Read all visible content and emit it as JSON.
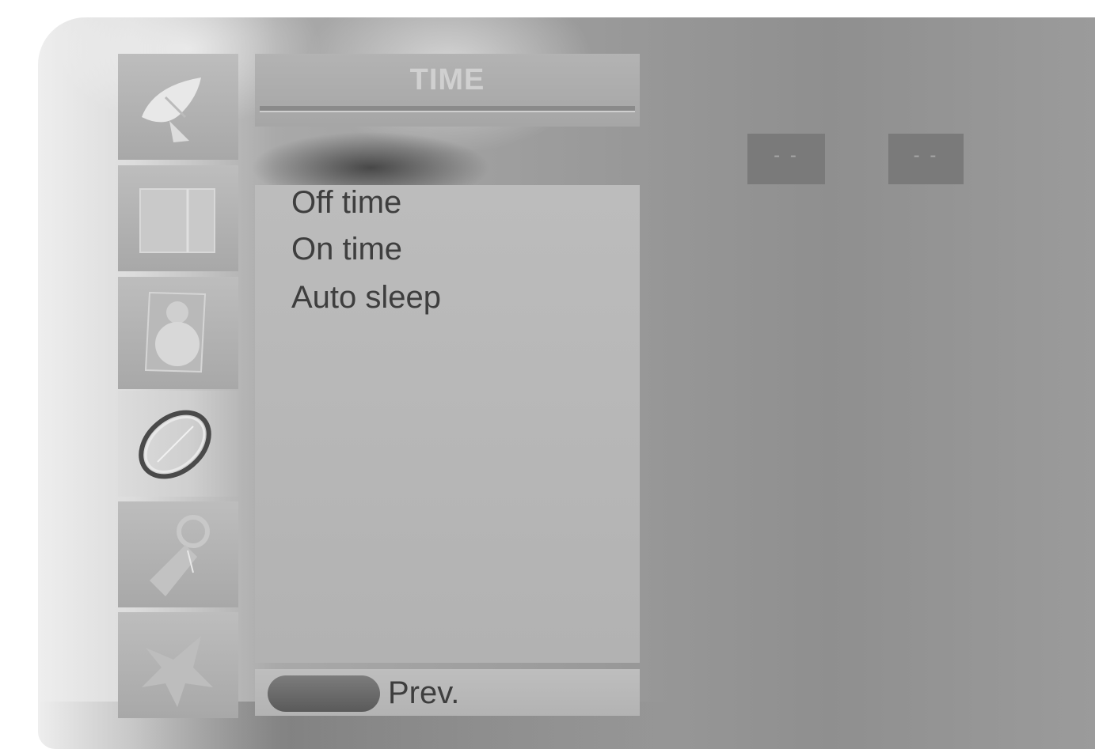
{
  "menu": {
    "title": "TIME",
    "items": [
      {
        "label": "Off time"
      },
      {
        "label": "On time"
      },
      {
        "label": "Auto sleep"
      }
    ]
  },
  "footer": {
    "prev_label": "Prev."
  },
  "values": {
    "hour": "- -",
    "minute": "- -"
  },
  "sidebar": {
    "icons": [
      "satellite-dish-icon",
      "picture-icon",
      "speaker-icon",
      "clock-icon",
      "key-icon",
      "tools-icon"
    ],
    "active_index": 3
  }
}
